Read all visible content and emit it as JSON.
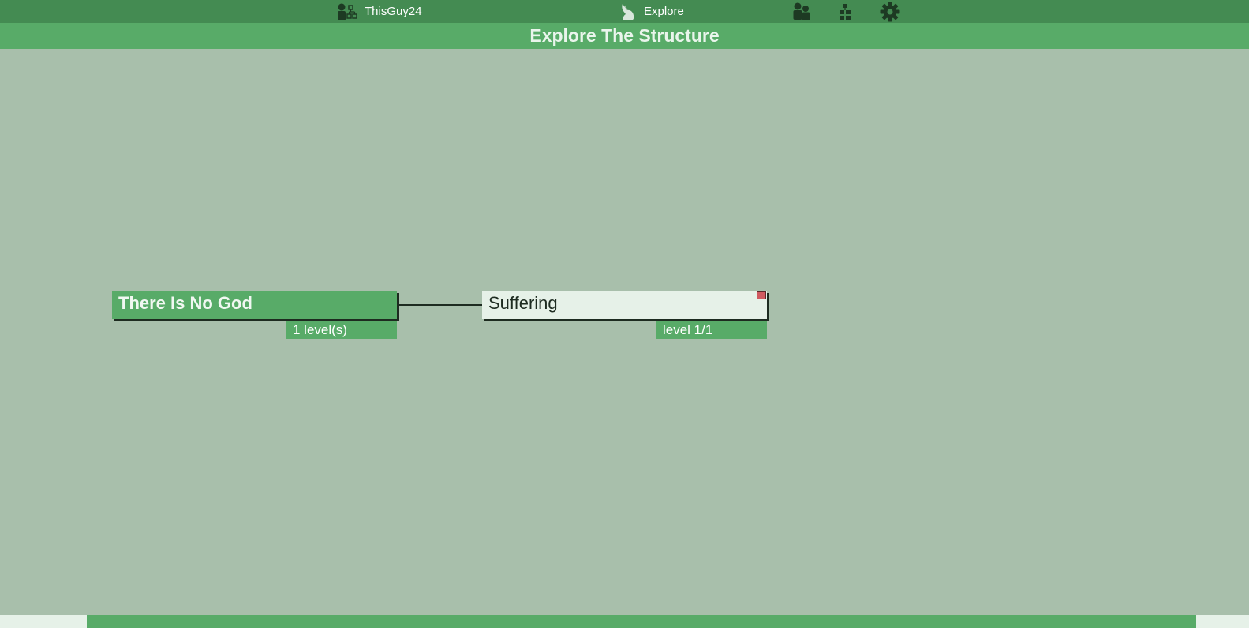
{
  "nav": {
    "user_label": "ThisGuy24",
    "user_icon": "user-structure-icon",
    "explore_label": "Explore",
    "explore_icon": "bunny-icon",
    "people_icon": "people-icon",
    "hierarchy_icon": "hierarchy-icon",
    "settings_icon": "gear-icon"
  },
  "page": {
    "title": "Explore The Structure"
  },
  "graph": {
    "root": {
      "title": "There Is No God",
      "badge": "1 level(s)"
    },
    "child": {
      "title": "Suffering",
      "badge": "level 1/1",
      "flag_color": "#d05a60"
    }
  },
  "colors": {
    "topbar": "#448b52",
    "accent": "#58ab68",
    "background": "#a8bfab",
    "node_light": "#e6f1e8",
    "dark": "#1d2b20"
  }
}
